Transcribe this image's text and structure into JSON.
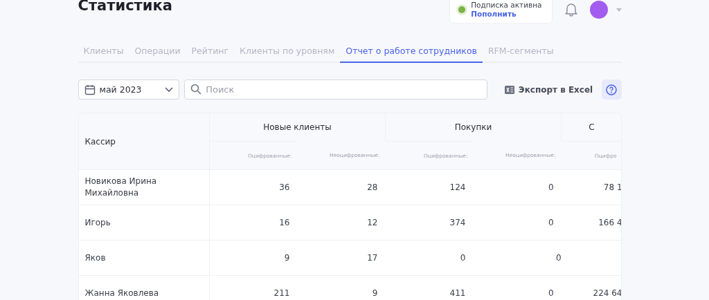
{
  "page_title": "Статистика",
  "subscription": {
    "status": "Подписка активна",
    "link": "Пополнить",
    "color": "#7cb342"
  },
  "tabs": [
    {
      "label": "Клиенты",
      "selected": false
    },
    {
      "label": "Операции",
      "selected": false
    },
    {
      "label": "Рейтинг",
      "selected": false
    },
    {
      "label": "Клиенты по уровням",
      "selected": false
    },
    {
      "label": "Отчет о работе сотрудников",
      "selected": true
    },
    {
      "label": "RFM-сегменты",
      "selected": false
    }
  ],
  "toolbar": {
    "period": "май 2023",
    "search_placeholder": "Поиск",
    "export": "Экспорт в Excel"
  },
  "table": {
    "cashier_header": "Кассир",
    "groups": [
      {
        "title": "Новые клиенты",
        "subcolumns": [
          "Оцифрованные:",
          "Неоцифрованные:"
        ]
      },
      {
        "title": "Покупки",
        "subcolumns": [
          "Оцифрованные:",
          "Неоцифрованные:"
        ]
      },
      {
        "title": "С",
        "subcolumns": [
          "Оцифро"
        ]
      }
    ],
    "rows": [
      {
        "cashier": "Новикова Ирина Михайловна",
        "values": [
          "36",
          "28",
          "124",
          "0",
          "78 1"
        ]
      },
      {
        "cashier": "Игорь",
        "values": [
          "16",
          "12",
          "374",
          "0",
          "166 4"
        ]
      },
      {
        "cashier": "Яков",
        "values": [
          "9",
          "17",
          "0",
          "0"
        ]
      },
      {
        "cashier": "Жанна Яковлева",
        "values": [
          "211",
          "9",
          "411",
          "0",
          "224 64"
        ]
      }
    ]
  }
}
